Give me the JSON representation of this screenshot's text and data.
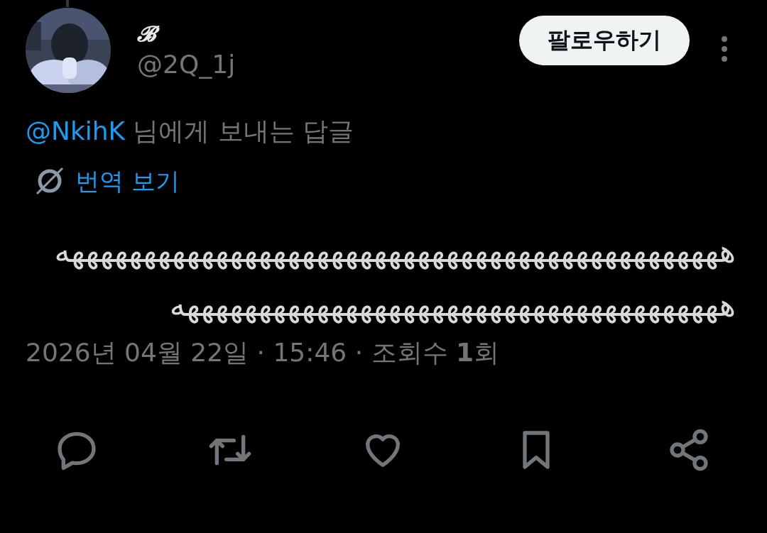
{
  "author": {
    "name": "𝓑",
    "handle": "@2Q_1j"
  },
  "follow_button": "팔로우하기",
  "reply_to": {
    "mention": "@NkihK",
    "text": "님에게 보내는 답글"
  },
  "translate_link": "번역 보기",
  "body": "ههههههههههههههههههههههههههههههههههههههههههههههه ههههههههههههههههههههههههههههههههههههههه",
  "meta": "2026년 04월 22일 · 15:46 · 조회수 **1**회",
  "actions": [
    {
      "kind": "reply"
    },
    {
      "kind": "retweet"
    },
    {
      "kind": "like"
    },
    {
      "kind": "bookmark"
    },
    {
      "kind": "share"
    }
  ]
}
